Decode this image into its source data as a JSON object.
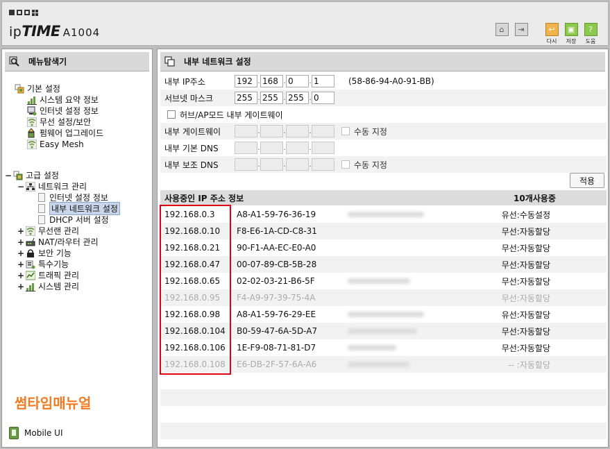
{
  "header": {
    "logo_ip": "ip",
    "logo_time": "TIME",
    "logo_model": "A1004",
    "icons": [
      {
        "name": "home-icon",
        "glyph": "⌂",
        "caption": ""
      },
      {
        "name": "logout-icon",
        "glyph": "⇥",
        "caption": ""
      },
      {
        "name": "refresh-icon",
        "glyph": "↩",
        "caption": "다시"
      },
      {
        "name": "save-icon",
        "glyph": "▣",
        "caption": "저장"
      },
      {
        "name": "help-icon",
        "glyph": "?",
        "caption": "도움"
      }
    ]
  },
  "sidebar": {
    "title": "메뉴탐색기",
    "basic": {
      "label": "기본 설정",
      "items": [
        "시스템 요약 정보",
        "인터넷 설정 정보",
        "무선 설정/보안",
        "펌웨어 업그레이드",
        "Easy Mesh"
      ]
    },
    "advanced": {
      "toggle": "−",
      "label": "고급 설정",
      "network": {
        "toggle": "−",
        "label": "네트워크 관리",
        "items": [
          "인터넷 설정 정보",
          "내부 네트워크 설정",
          "DHCP 서버 설정"
        ]
      },
      "others": [
        {
          "toggle": "+",
          "label": "무선랜 관리"
        },
        {
          "toggle": "+",
          "label": "NAT/라우터 관리"
        },
        {
          "toggle": "+",
          "label": "보안 기능"
        },
        {
          "toggle": "+",
          "label": "특수기능"
        },
        {
          "toggle": "+",
          "label": "트래픽 관리"
        },
        {
          "toggle": "+",
          "label": "시스템 관리"
        }
      ]
    },
    "watermark": "썸타임매뉴얼",
    "mobile_label": "Mobile UI"
  },
  "main": {
    "title": "내부 네트워크 설정",
    "ip_label": "내부 IP주소",
    "ip": [
      "192",
      "168",
      "0",
      "1"
    ],
    "mac": "(58-86-94-A0-91-BB)",
    "mask_label": "서브넷 마스크",
    "mask": [
      "255",
      "255",
      "255",
      "0"
    ],
    "hub_label": "허브/AP모드 내부 게이트웨이",
    "gw_label": "내부 게이트웨이",
    "manual_label": "수동 지정",
    "dns1_label": "내부 기본 DNS",
    "dns2_label": "내부 보조 DNS",
    "dns_manual_label": "수동 지정",
    "apply_label": "적용",
    "list_title": "사용중인 IP 주소 정보",
    "list_count": "10개사용중",
    "rows": [
      {
        "ip": "192.168.0.3",
        "mac": "A8-A1-59-76-36-19",
        "type": "유선:수동설정",
        "off": false
      },
      {
        "ip": "192.168.0.10",
        "mac": "F8-E6-1A-CD-C8-31",
        "type": "무선:자동할당",
        "off": false
      },
      {
        "ip": "192.168.0.21",
        "mac": "90-F1-AA-EC-E0-A0",
        "type": "무선:자동할당",
        "off": false
      },
      {
        "ip": "192.168.0.47",
        "mac": "00-07-89-CB-5B-28",
        "type": "무선:자동할당",
        "off": false
      },
      {
        "ip": "192.168.0.65",
        "mac": "02-02-03-21-B6-5F",
        "type": "무선:자동할당",
        "off": false
      },
      {
        "ip": "192.168.0.95",
        "mac": "F4-A9-97-39-75-4A",
        "type": "무선:자동할당",
        "off": true
      },
      {
        "ip": "192.168.0.98",
        "mac": "A8-A1-59-76-29-EE",
        "type": "유선:자동할당",
        "off": false
      },
      {
        "ip": "192.168.0.104",
        "mac": "B0-59-47-6A-5D-A7",
        "type": "무선:자동할당",
        "off": false
      },
      {
        "ip": "192.168.0.106",
        "mac": "1E-F9-08-71-81-D7",
        "type": "무선:자동할당",
        "off": false
      },
      {
        "ip": "192.168.0.108",
        "mac": "E6-DB-2F-57-6A-A6",
        "type": "-- :자동할당",
        "off": true
      }
    ]
  }
}
